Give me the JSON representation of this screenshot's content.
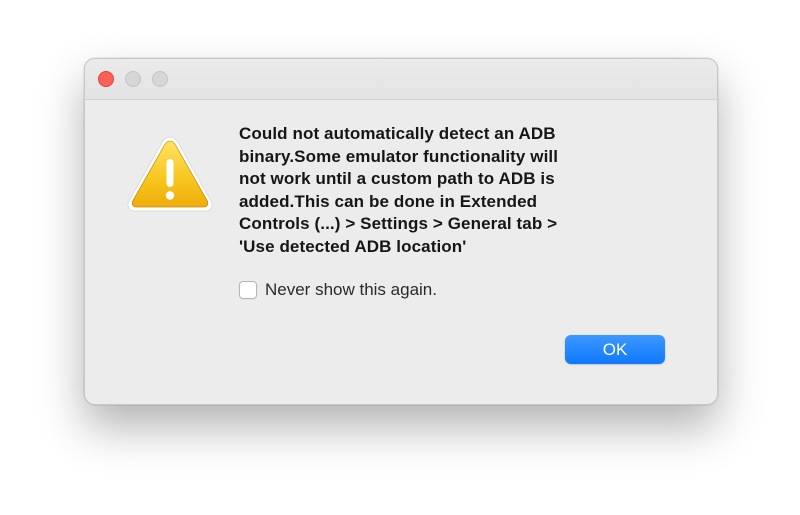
{
  "window": {
    "controls": {
      "close": "close-button",
      "minimize": "minimize-button",
      "zoom": "zoom-button"
    }
  },
  "dialog": {
    "icon": "warning-triangle-icon",
    "message_lines": [
      "Could not automatically detect an ADB",
      "binary.Some emulator functionality will",
      "not work until a custom path to ADB  is",
      "added.This can be done in Extended",
      "Controls (...) > Settings > General tab >",
      "'Use detected ADB location'"
    ],
    "checkbox": {
      "label": "Never show this again.",
      "checked": false
    },
    "ok_label": "OK"
  },
  "colors": {
    "accent": "#1a82ff",
    "close_red": "#fe5f57",
    "warning_yellow": "#f5c21b"
  }
}
